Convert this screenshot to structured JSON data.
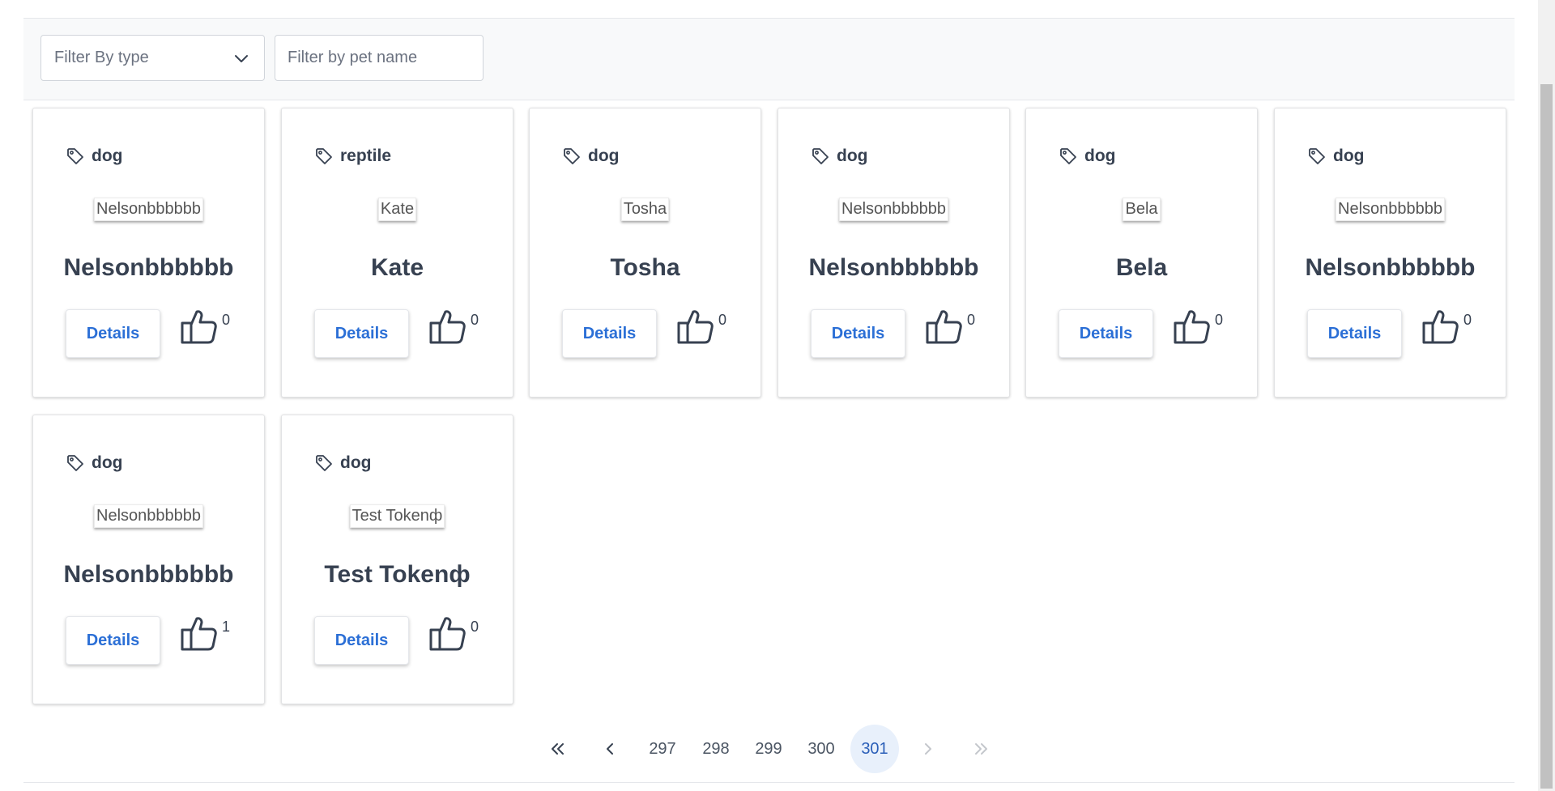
{
  "filters": {
    "type_label": "Filter By type",
    "name_placeholder": "Filter by pet name",
    "name_value": ""
  },
  "pets": [
    {
      "type": "dog",
      "image_alt": "Nelsonbbbbbb",
      "name": "Nelsonbbbbbb",
      "button": "Details",
      "likes": "0"
    },
    {
      "type": "reptile",
      "image_alt": "Kate",
      "name": "Kate",
      "button": "Details",
      "likes": "0"
    },
    {
      "type": "dog",
      "image_alt": "Tosha",
      "name": "Tosha",
      "button": "Details",
      "likes": "0"
    },
    {
      "type": "dog",
      "image_alt": "Nelsonbbbbbb",
      "name": "Nelsonbbbbbb",
      "button": "Details",
      "likes": "0"
    },
    {
      "type": "dog",
      "image_alt": "Bela",
      "name": "Bela",
      "button": "Details",
      "likes": "0"
    },
    {
      "type": "dog",
      "image_alt": "Nelsonbbbbbb",
      "name": "Nelsonbbbbbb",
      "button": "Details",
      "likes": "0"
    },
    {
      "type": "dog",
      "image_alt": "Nelsonbbbbbb",
      "name": "Nelsonbbbbbb",
      "button": "Details",
      "likes": "1"
    },
    {
      "type": "dog",
      "image_alt": "Test Tokenф",
      "name": "Test Tokenф",
      "button": "Details",
      "likes": "0"
    }
  ],
  "pagination": {
    "first_icon": "double-chevron-left-icon",
    "prev_icon": "chevron-left-icon",
    "pages": [
      "297",
      "298",
      "299",
      "300",
      "301"
    ],
    "current": "301",
    "next_icon": "chevron-right-icon",
    "last_icon": "double-chevron-right-icon"
  },
  "colors": {
    "accent": "#2b6fd6",
    "active_page_bg": "#e8f0fb",
    "filter_bar_bg": "#f8f9fa",
    "text": "#374151"
  }
}
